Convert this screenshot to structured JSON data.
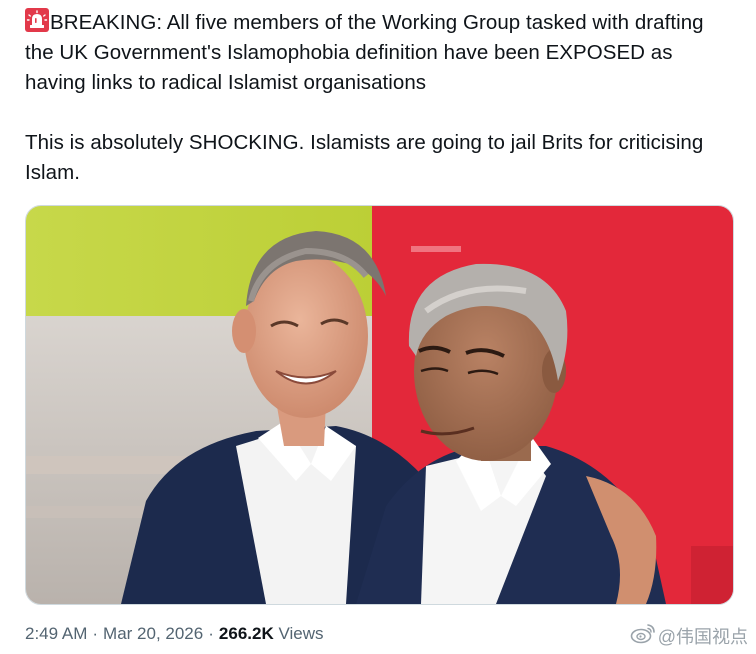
{
  "tweet": {
    "emoji": "rotating-light-emoji",
    "paragraph_1": "BREAKING: All five members of the Working Group tasked with drafting the UK Government's Islamophobia definition have been EXPOSED as having links to radical Islamist organisations",
    "paragraph_2": "This is absolutely SHOCKING. Islamists are going to jail Brits for criticising Islam.",
    "image": "photo-two-men-smiling-red-and-green-background"
  },
  "meta": {
    "time": "2:49 AM",
    "separator": "·",
    "date": "Mar 20, 2026",
    "views_count": "266.2K",
    "views_label": "Views"
  },
  "watermark": {
    "logo": "weibo-logo",
    "text": "@伟国视点"
  },
  "colors": {
    "text": "#0f1419",
    "muted": "#536471",
    "border": "#cfd9de",
    "photo_red": "#e3283a",
    "photo_green": "#c3d63c"
  }
}
